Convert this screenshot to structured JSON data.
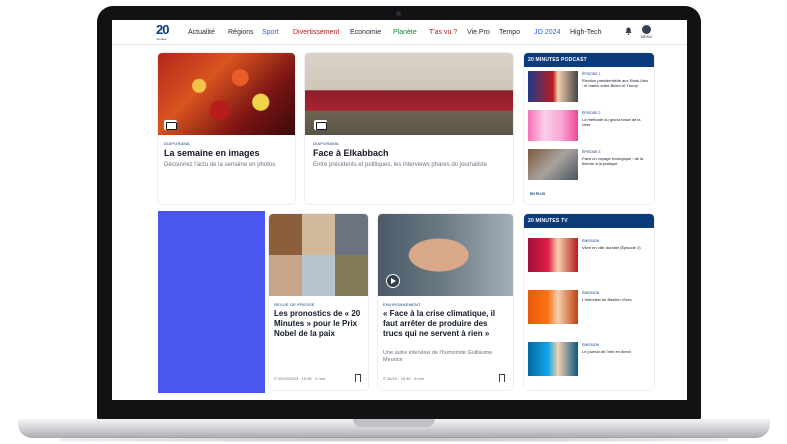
{
  "nav": {
    "logo": "20",
    "logo_sub": "minutes",
    "items": [
      "Actualité",
      "Régions",
      "Sport",
      "Divertissement",
      "Economie",
      "Planète",
      "T'as vu ?",
      "Vie Pro",
      "Tempo",
      "JO 2024",
      "High-Tech"
    ],
    "menu_label": "MENU"
  },
  "cards": {
    "semaine": {
      "category": "DIAPORAMA",
      "title": "La semaine en images",
      "desc": "Découvrez l'actu de la semaine en photos"
    },
    "face": {
      "category": "DIAPORAMA",
      "title": "Face à Elkabbach",
      "desc": "Entre présidents et politiques, les interviews phares du journaliste"
    },
    "nobel": {
      "category": "REVUE DE PRESSE",
      "title": "Les pronostics de « 20 Minutes » pour le Prix Nobel de la paix",
      "meta": "© 05/10/2023 · 15:45 · 4 min"
    },
    "climat": {
      "category": "ENVIRONNEMENT",
      "title": "« Face à la crise climatique, il faut arrêter de produire des trucs qui ne servent à rien »",
      "desc": "Une autre interview de l'humoriste Guillaume Meurice",
      "meta": "© 05/10 · 16:30 · 6 min"
    }
  },
  "podcast": {
    "header": "20 MINUTES PODCAST",
    "items": [
      {
        "category": "ÉPISODE 1",
        "text": "Election présidentielle aux Etats-Unis : le match entre Biden et Trump"
      },
      {
        "category": "ÉPISODE 2",
        "text": "La méthode du grand fossé de la crise"
      },
      {
        "category": "ÉPISODE 3",
        "text": "Faire un voyage écologique : de la théorie à la pratique"
      }
    ],
    "more": "EN PLUS"
  },
  "tv": {
    "header": "20 MINUTES TV",
    "items": [
      {
        "category": "ÉMISSION",
        "text": "Vivre en ville durable (Épisode 2)"
      },
      {
        "category": "ÉMISSION",
        "text": "L'interview de Bastien Vives"
      },
      {
        "category": "ÉMISSION",
        "text": "Le journal de l'info en direct"
      }
    ]
  },
  "colors": {
    "brand": "#0b3b7a",
    "ad_block": "#4b55f0"
  },
  "icons": [
    "bell-icon",
    "menu-icon",
    "photo-gallery-icon",
    "play-icon",
    "bookmark-icon"
  ]
}
